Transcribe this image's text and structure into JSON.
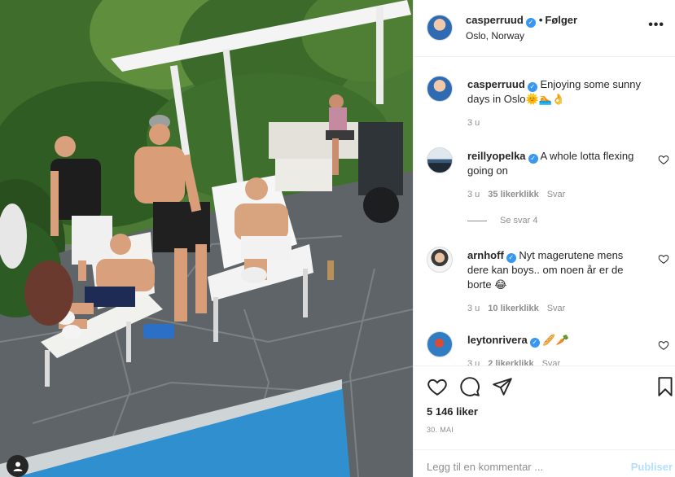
{
  "post": {
    "author": "casperruud",
    "follow_status": "Følger",
    "dot": "•",
    "location": "Oslo, Norway",
    "more_icon": "more-options-icon",
    "verified_icon": "verified-badge-icon",
    "verified_glyph": "✓"
  },
  "caption": {
    "username": "casperruud",
    "text": "Enjoying some sunny days in Oslo🌞🏊👌",
    "time": "3 u"
  },
  "comments": [
    {
      "username": "reillyopelka",
      "text": "A whole lotta flexing going on",
      "time": "3 u",
      "likes": "35 likerklikk",
      "reply": "Svar",
      "view_replies": "Se svar 4"
    },
    {
      "username": "arnhoff",
      "text": "Nyt magerutene mens dere kan boys.. om noen år er de borte 😂",
      "time": "3 u",
      "likes": "10 likerklikk",
      "reply": "Svar"
    },
    {
      "username": "leytonrivera",
      "text": "🥖🥕",
      "time": "3 u",
      "likes": "2 likerklikk",
      "reply": "Svar"
    }
  ],
  "actions": {
    "like_icon": "heart-icon",
    "comment_icon": "comment-icon",
    "share_icon": "share-icon",
    "save_icon": "bookmark-icon",
    "likes_count": "5 146 liker",
    "date": "30. MAI"
  },
  "add_comment": {
    "placeholder": "Legg til en kommentar ...",
    "post_label": "Publiser"
  },
  "colors": {
    "verified": "#3897f0",
    "publish_disabled": "#b2dffc",
    "meta_gray": "#8e8e8e"
  }
}
